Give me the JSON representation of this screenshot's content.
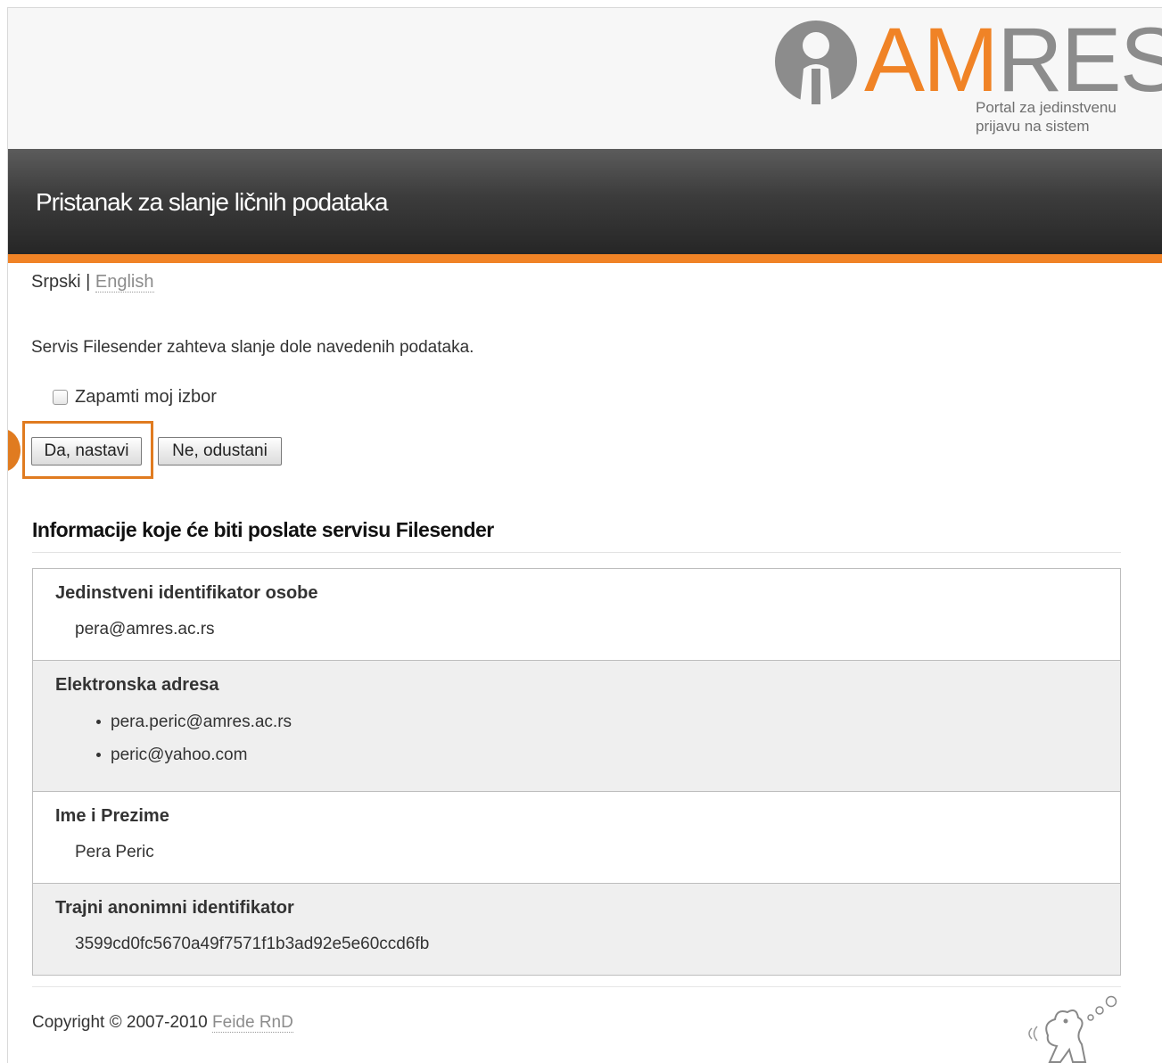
{
  "header": {
    "logo_text_accent": "AM",
    "logo_text_main": "RES",
    "logo_tagline_line1": "Portal za jedinstvenu",
    "logo_tagline_line2": "prijavu na sistem",
    "title": "Pristanak za slanje ličnih podataka"
  },
  "language": {
    "current": "Srpski",
    "separator": "|",
    "other": "English"
  },
  "consent": {
    "intro": "Servis Filesender zahteva slanje dole navedenih podataka.",
    "remember_label": "Zapamti moj izbor",
    "remember_checked": false,
    "yes_button": "Da, nastavi",
    "no_button": "Ne, odustani"
  },
  "attributes": {
    "title": "Informacije koje će biti poslate servisu Filesender",
    "rows": [
      {
        "name": "Jedinstveni identifikator osobe",
        "value": "pera@amres.ac.rs"
      },
      {
        "name": "Elektronska adresa",
        "values": [
          "pera.peric@amres.ac.rs",
          "peric@yahoo.com"
        ]
      },
      {
        "name": "Ime i Prezime",
        "value": "Pera Peric"
      },
      {
        "name": "Trajni anonimni identifikator",
        "value": "3599cd0fc5670a49f7571f1b3ad92e5e60ccd6fb"
      }
    ]
  },
  "footer": {
    "copyright": "Copyright © 2007-2010",
    "link": "Feide RnD"
  },
  "colors": {
    "accent": "#f08326",
    "logo_gray": "#8c8c8c",
    "annotation": "#e07b20"
  },
  "icons": {
    "logo": "amres-logo",
    "mascot": "feide-mascot-icon"
  }
}
